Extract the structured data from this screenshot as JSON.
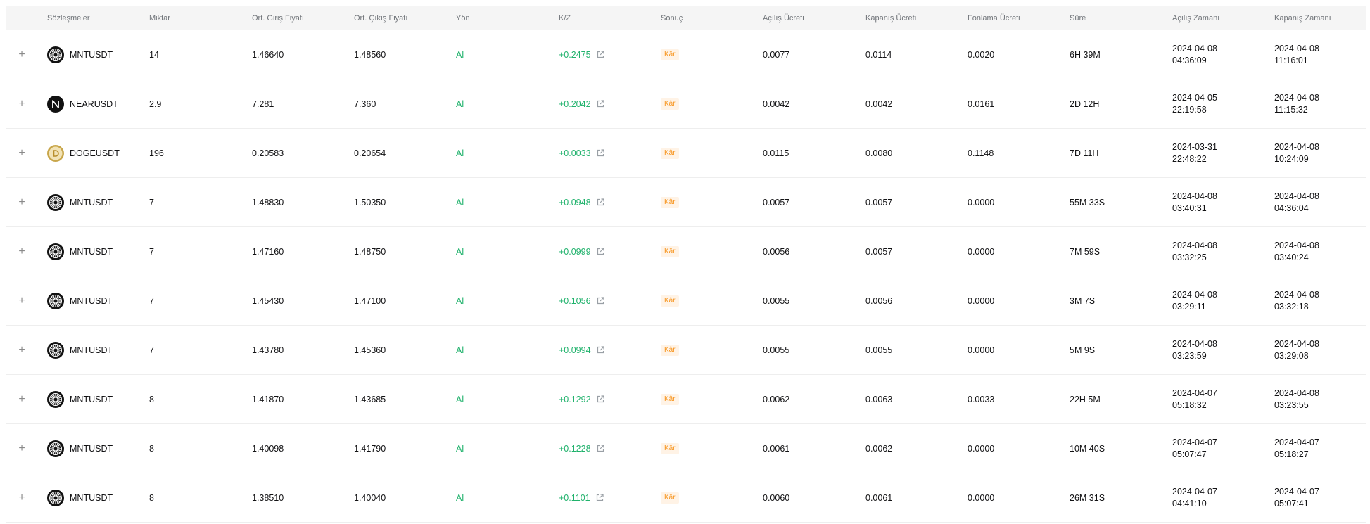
{
  "colors": {
    "profit_green": "#20b26c",
    "badge_bg": "#fff3e6",
    "badge_text": "#f7931a",
    "header_bg": "#f5f5f5"
  },
  "headers": {
    "contracts": "Sözleşmeler",
    "quantity": "Miktar",
    "entry_price": "Ort. Giriş Fiyatı",
    "exit_price": "Ort. Çıkış Fiyatı",
    "side": "Yön",
    "pnl": "K/Z",
    "result": "Sonuç",
    "open_fee": "Açılış Ücreti",
    "close_fee": "Kapanış Ücreti",
    "funding_fee": "Fonlama Ücreti",
    "duration": "Süre",
    "open_time": "Açılış Zamanı",
    "close_time": "Kapanış Zamanı"
  },
  "icons": {
    "expand": "plus-icon",
    "pnl_link": "external-link-icon"
  },
  "expand_symbol": "+",
  "rows": [
    {
      "icon": "mnt",
      "symbol": "MNTUSDT",
      "qty": "14",
      "entry": "1.46640",
      "exit": "1.48560",
      "side": "Al",
      "pnl": "+0.2475",
      "result": "Kâr",
      "open_fee": "0.0077",
      "close_fee": "0.0114",
      "funding": "0.0020",
      "duration": "6H 39M",
      "open_date": "2024-04-08",
      "open_time": "04:36:09",
      "close_date": "2024-04-08",
      "close_time": "11:16:01"
    },
    {
      "icon": "near",
      "symbol": "NEARUSDT",
      "qty": "2.9",
      "entry": "7.281",
      "exit": "7.360",
      "side": "Al",
      "pnl": "+0.2042",
      "result": "Kâr",
      "open_fee": "0.0042",
      "close_fee": "0.0042",
      "funding": "0.0161",
      "duration": "2D 12H",
      "open_date": "2024-04-05",
      "open_time": "22:19:58",
      "close_date": "2024-04-08",
      "close_time": "11:15:32"
    },
    {
      "icon": "doge",
      "symbol": "DOGEUSDT",
      "qty": "196",
      "entry": "0.20583",
      "exit": "0.20654",
      "side": "Al",
      "pnl": "+0.0033",
      "result": "Kâr",
      "open_fee": "0.0115",
      "close_fee": "0.0080",
      "funding": "0.1148",
      "duration": "7D 11H",
      "open_date": "2024-03-31",
      "open_time": "22:48:22",
      "close_date": "2024-04-08",
      "close_time": "10:24:09"
    },
    {
      "icon": "mnt",
      "symbol": "MNTUSDT",
      "qty": "7",
      "entry": "1.48830",
      "exit": "1.50350",
      "side": "Al",
      "pnl": "+0.0948",
      "result": "Kâr",
      "open_fee": "0.0057",
      "close_fee": "0.0057",
      "funding": "0.0000",
      "duration": "55M 33S",
      "open_date": "2024-04-08",
      "open_time": "03:40:31",
      "close_date": "2024-04-08",
      "close_time": "04:36:04"
    },
    {
      "icon": "mnt",
      "symbol": "MNTUSDT",
      "qty": "7",
      "entry": "1.47160",
      "exit": "1.48750",
      "side": "Al",
      "pnl": "+0.0999",
      "result": "Kâr",
      "open_fee": "0.0056",
      "close_fee": "0.0057",
      "funding": "0.0000",
      "duration": "7M 59S",
      "open_date": "2024-04-08",
      "open_time": "03:32:25",
      "close_date": "2024-04-08",
      "close_time": "03:40:24"
    },
    {
      "icon": "mnt",
      "symbol": "MNTUSDT",
      "qty": "7",
      "entry": "1.45430",
      "exit": "1.47100",
      "side": "Al",
      "pnl": "+0.1056",
      "result": "Kâr",
      "open_fee": "0.0055",
      "close_fee": "0.0056",
      "funding": "0.0000",
      "duration": "3M 7S",
      "open_date": "2024-04-08",
      "open_time": "03:29:11",
      "close_date": "2024-04-08",
      "close_time": "03:32:18"
    },
    {
      "icon": "mnt",
      "symbol": "MNTUSDT",
      "qty": "7",
      "entry": "1.43780",
      "exit": "1.45360",
      "side": "Al",
      "pnl": "+0.0994",
      "result": "Kâr",
      "open_fee": "0.0055",
      "close_fee": "0.0055",
      "funding": "0.0000",
      "duration": "5M 9S",
      "open_date": "2024-04-08",
      "open_time": "03:23:59",
      "close_date": "2024-04-08",
      "close_time": "03:29:08"
    },
    {
      "icon": "mnt",
      "symbol": "MNTUSDT",
      "qty": "8",
      "entry": "1.41870",
      "exit": "1.43685",
      "side": "Al",
      "pnl": "+0.1292",
      "result": "Kâr",
      "open_fee": "0.0062",
      "close_fee": "0.0063",
      "funding": "0.0033",
      "duration": "22H 5M",
      "open_date": "2024-04-07",
      "open_time": "05:18:32",
      "close_date": "2024-04-08",
      "close_time": "03:23:55"
    },
    {
      "icon": "mnt",
      "symbol": "MNTUSDT",
      "qty": "8",
      "entry": "1.40098",
      "exit": "1.41790",
      "side": "Al",
      "pnl": "+0.1228",
      "result": "Kâr",
      "open_fee": "0.0061",
      "close_fee": "0.0062",
      "funding": "0.0000",
      "duration": "10M 40S",
      "open_date": "2024-04-07",
      "open_time": "05:07:47",
      "close_date": "2024-04-07",
      "close_time": "05:18:27"
    },
    {
      "icon": "mnt",
      "symbol": "MNTUSDT",
      "qty": "8",
      "entry": "1.38510",
      "exit": "1.40040",
      "side": "Al",
      "pnl": "+0.1101",
      "result": "Kâr",
      "open_fee": "0.0060",
      "close_fee": "0.0061",
      "funding": "0.0000",
      "duration": "26M 31S",
      "open_date": "2024-04-07",
      "open_time": "04:41:10",
      "close_date": "2024-04-07",
      "close_time": "05:07:41"
    }
  ]
}
